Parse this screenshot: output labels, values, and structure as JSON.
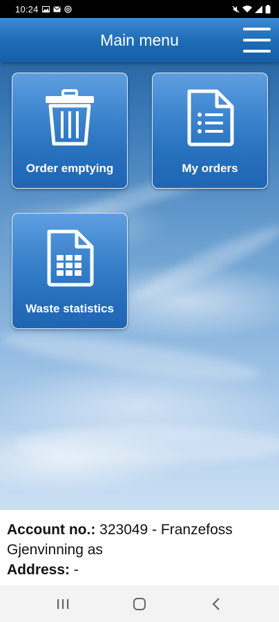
{
  "status_bar": {
    "time": "10:24"
  },
  "header": {
    "title": "Main menu",
    "menu_icon": "hamburger-menu-icon"
  },
  "tiles": [
    {
      "label": "Order emptying",
      "icon": "trash-bin-icon"
    },
    {
      "label": "My orders",
      "icon": "document-list-icon"
    },
    {
      "label": "Waste statistics",
      "icon": "spreadsheet-icon"
    }
  ],
  "account": {
    "account_label": "Account no.:",
    "account_value": " 323049 - Franzefoss Gjenvinning as",
    "address_label": "Address:",
    "address_value": " -"
  },
  "nav": {
    "recents_icon": "recent-apps-icon",
    "home_icon": "home-icon",
    "back_icon": "back-icon"
  },
  "colors": {
    "header": "#1d6bb6",
    "tile": "#3f86cf"
  }
}
